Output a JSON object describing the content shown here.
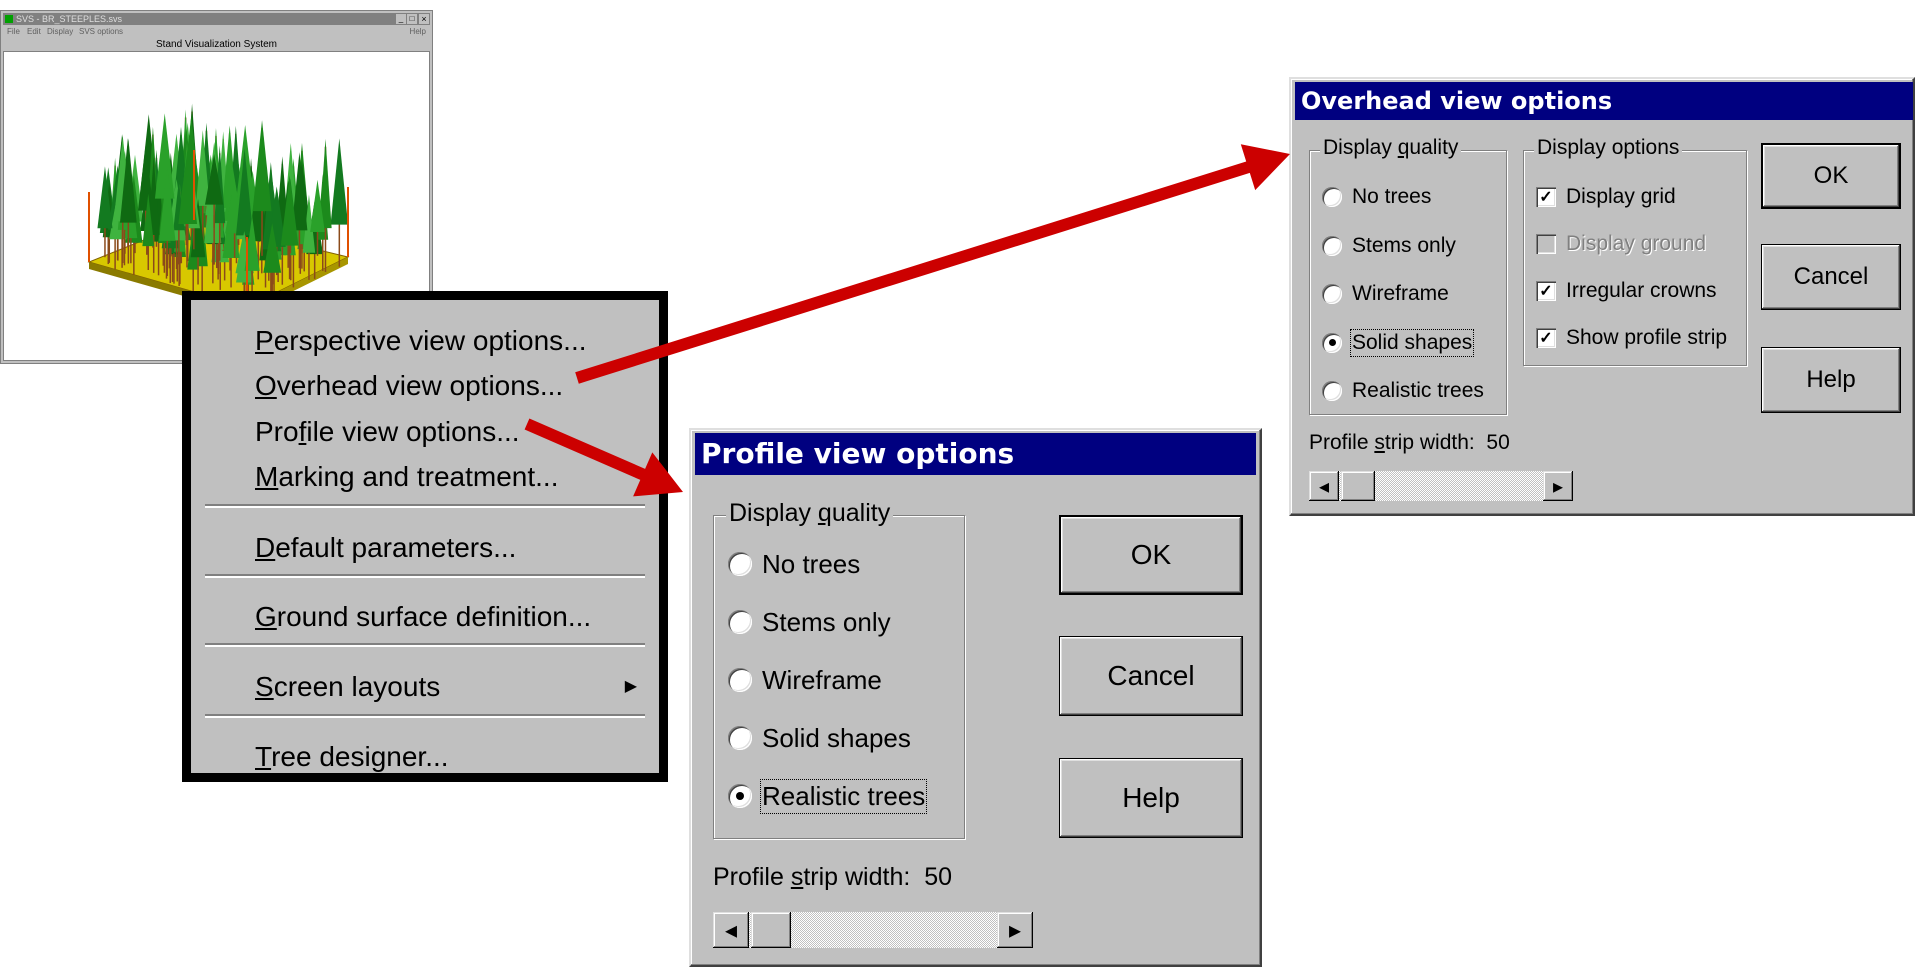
{
  "app_window": {
    "title": "SVS - BR_STEEPLES.svs",
    "menu": [
      "File",
      "Edit",
      "Display",
      "SVS options"
    ],
    "help": "Help",
    "caption": "Stand Visualization System"
  },
  "context_menu": {
    "items": [
      {
        "accel": "P",
        "rest": "erspective view options..."
      },
      {
        "accel": "O",
        "rest": "verhead view options..."
      },
      {
        "pre": "Pro",
        "accel": "f",
        "rest": "ile view options..."
      },
      {
        "accel": "M",
        "rest": "arking and treatment..."
      },
      {
        "accel": "D",
        "rest": "efault parameters..."
      },
      {
        "accel": "G",
        "rest": "round surface definition..."
      },
      {
        "accel": "S",
        "rest": "creen layouts",
        "submenu": "▶"
      },
      {
        "accel": "T",
        "rest": "ree designer..."
      }
    ]
  },
  "overhead_dialog": {
    "title": "Overhead view options",
    "quality_legend_pre": "Display ",
    "quality_legend_accel": "q",
    "quality_legend_post": "uality",
    "quality_options": [
      "No trees",
      "Stems only",
      "Wireframe",
      "Solid shapes",
      "Realistic trees"
    ],
    "quality_selected": "Solid shapes",
    "display_legend": "Display options",
    "display_options": [
      {
        "label": "Display grid",
        "checked": true,
        "enabled": true
      },
      {
        "label": "Display ground",
        "checked": false,
        "enabled": false
      },
      {
        "label": "Irregular crowns",
        "checked": true,
        "enabled": true
      },
      {
        "label": "Show profile strip",
        "checked": true,
        "enabled": true
      }
    ],
    "ok": "OK",
    "cancel": "Cancel",
    "help": "Help",
    "strip_pre": "Profile ",
    "strip_accel": "s",
    "strip_post": "trip width:",
    "strip_value": "50"
  },
  "profile_dialog": {
    "title": "Profile view options",
    "quality_legend_pre": "Display ",
    "quality_legend_accel": "q",
    "quality_legend_post": "uality",
    "quality_options": [
      "No trees",
      "Stems only",
      "Wireframe",
      "Solid shapes",
      "Realistic trees"
    ],
    "quality_selected": "Realistic trees",
    "ok": "OK",
    "cancel": "Cancel",
    "help": "Help",
    "strip_pre": "Profile ",
    "strip_accel": "s",
    "strip_post": "trip width:",
    "strip_value": "50"
  },
  "icons": {
    "scroll_left": "◂",
    "scroll_right": "▸",
    "check": "✓",
    "win_minimize": "_",
    "win_maximize": "□",
    "win_close": "×"
  },
  "colors": {
    "titlebar": "#000080",
    "arrow": "#cc0000",
    "dialog_face": "#c0c0c0"
  }
}
